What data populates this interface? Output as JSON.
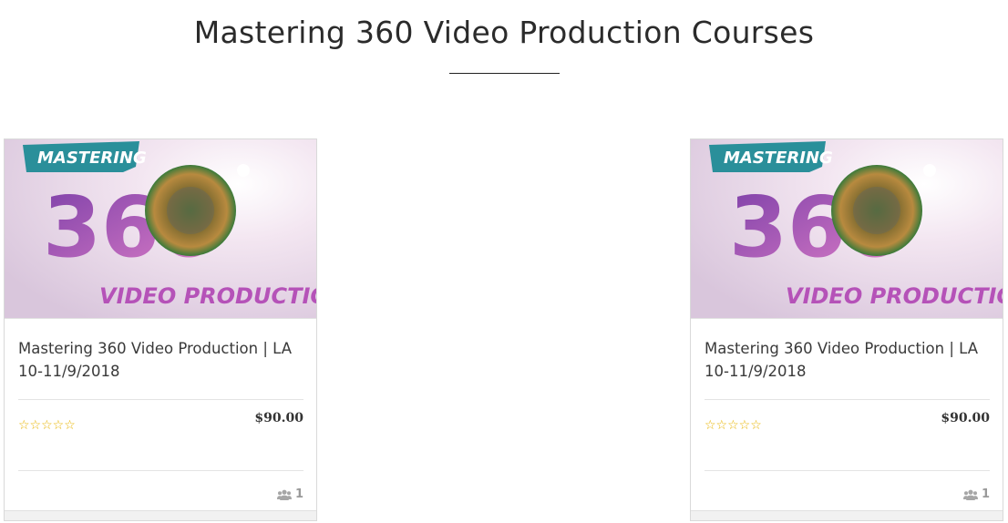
{
  "section": {
    "title": "Mastering 360 Video Production Courses"
  },
  "colors": {
    "star": "#e8b400",
    "title_text": "#2b2b2b",
    "muted": "#999999"
  },
  "courses": [
    {
      "thumbnail": {
        "word_top": "MASTERING",
        "number": "360",
        "word_bottom": "VIDEO PRODUCTION"
      },
      "title": "Mastering 360 Video Production | LA 10-11/9/2018",
      "rating": 0,
      "rating_max": 5,
      "price": "$90.00",
      "students": "1",
      "students_icon": "users-icon"
    },
    {
      "thumbnail": {
        "word_top": "MASTERING",
        "number": "360",
        "word_bottom": "VIDEO PRODUCTION"
      },
      "title": "Mastering 360 Video Production | LA 10-11/9/2018",
      "rating": 0,
      "rating_max": 5,
      "price": "$90.00",
      "students": "1",
      "students_icon": "users-icon"
    }
  ]
}
